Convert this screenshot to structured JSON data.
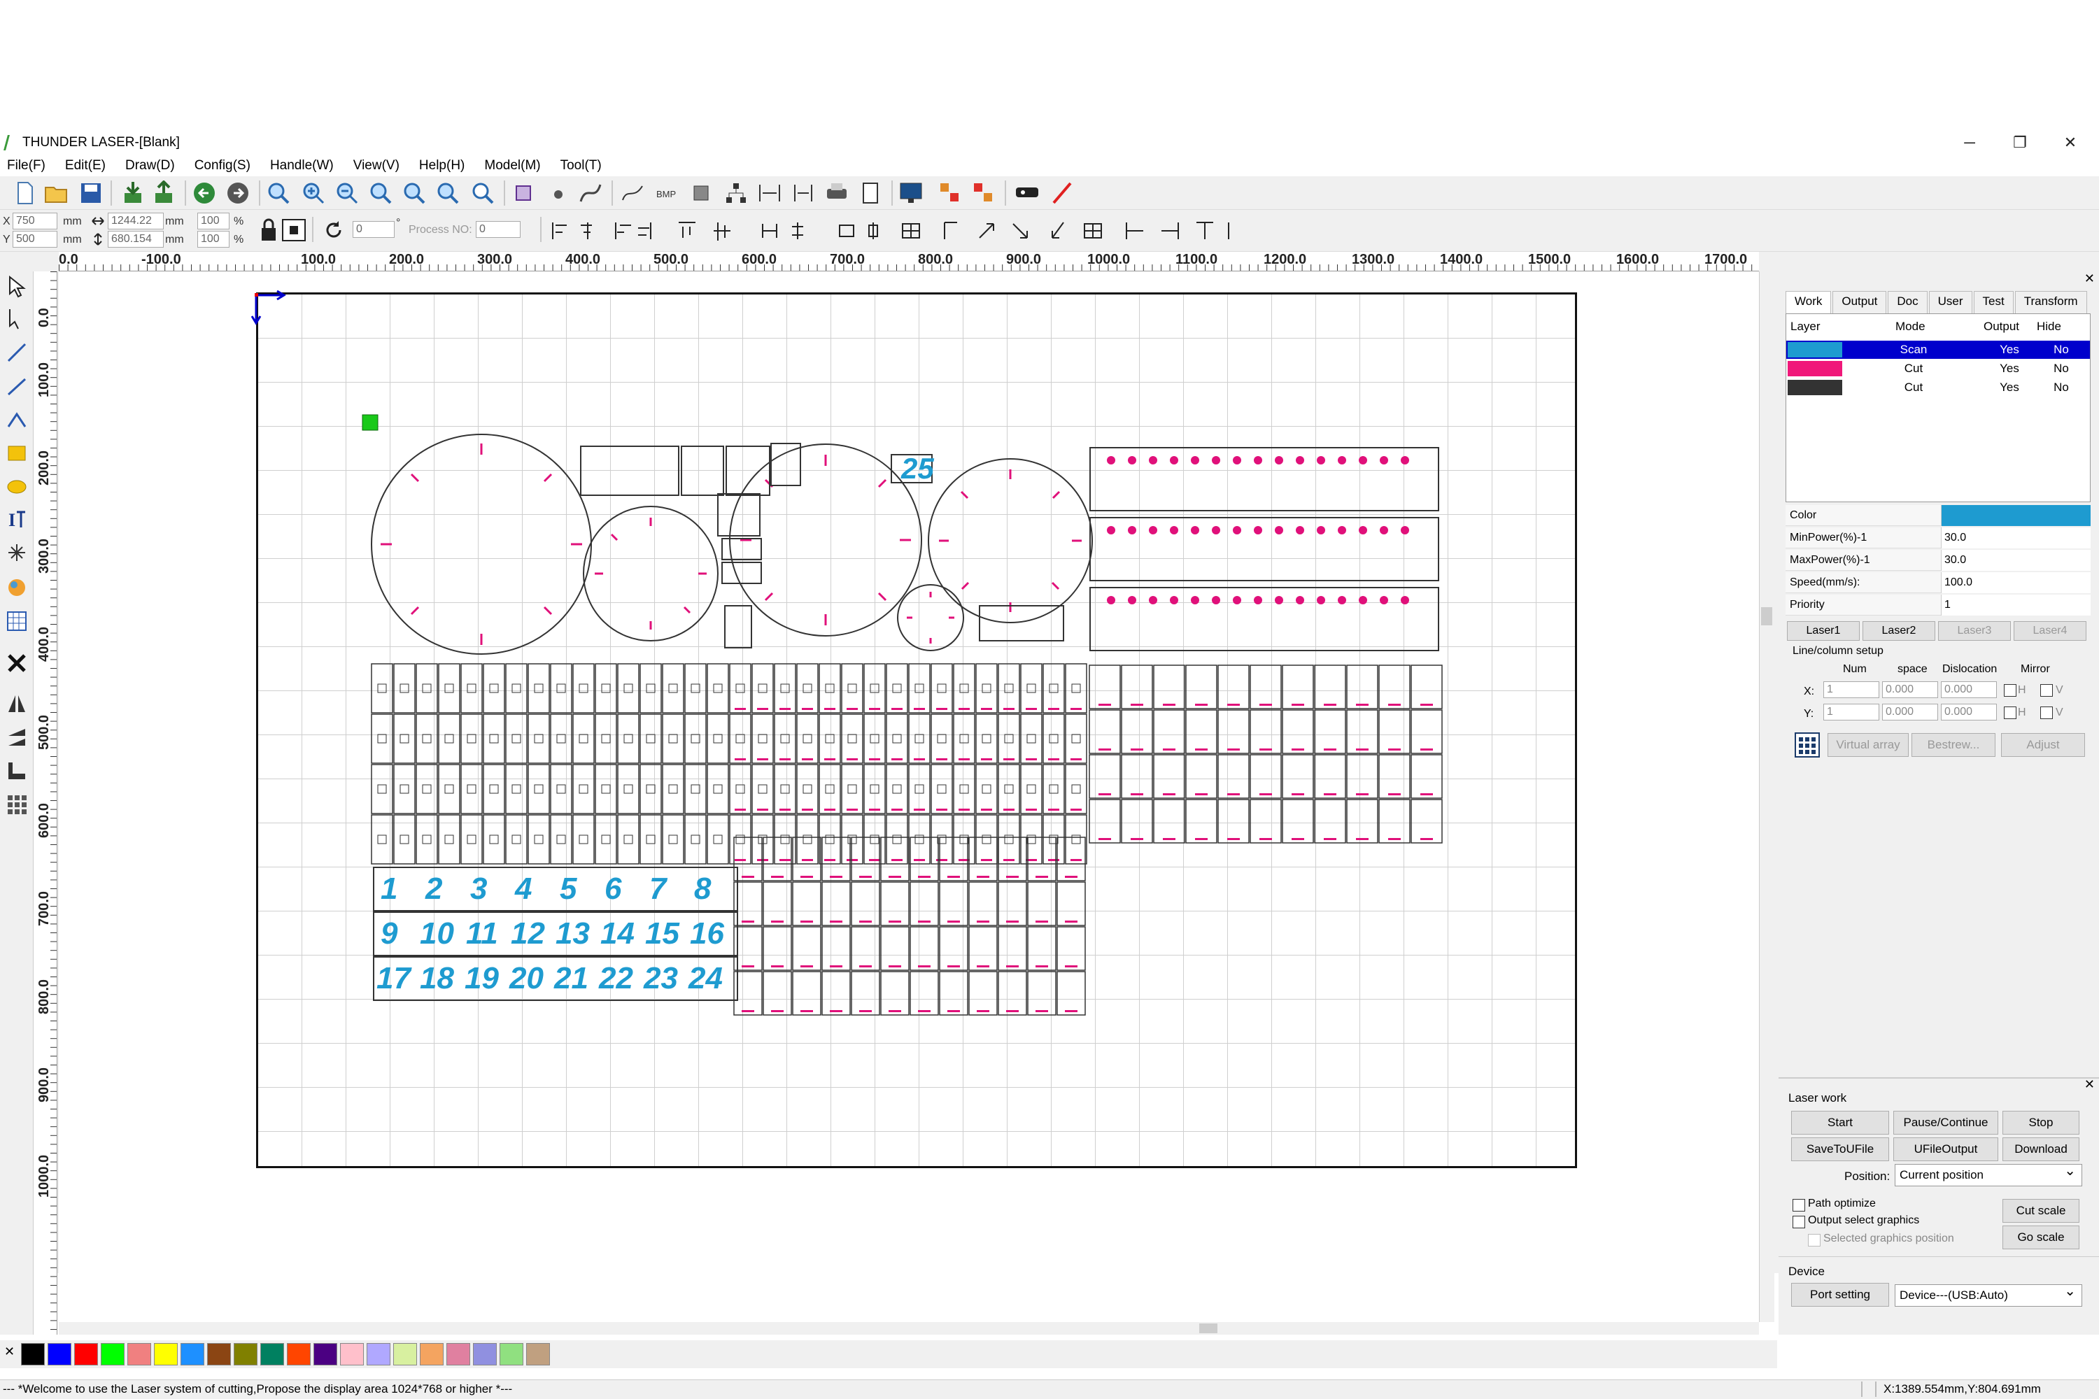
{
  "window": {
    "title": "THUNDER LASER-[Blank]",
    "minimize": "─",
    "restore": "❐",
    "close": "✕"
  },
  "menu": [
    "File(F)",
    "Edit(E)",
    "Draw(D)",
    "Config(S)",
    "Handle(W)",
    "View(V)",
    "Help(H)",
    "Model(M)",
    "Tool(T)"
  ],
  "coords": {
    "x_label": "X",
    "y_label": "Y",
    "x_value": "750",
    "y_value": "500",
    "unit": "mm",
    "w_value": "1244.22",
    "h_value": "680.154",
    "w_unit": "mm",
    "h_unit": "mm",
    "sx": "100",
    "sy": "100",
    "pct": "%",
    "angle": "0",
    "deg": "°",
    "process_label": "Process NO:",
    "process_value": "0"
  },
  "ruler_h": [
    "0.0",
    "-100.0",
    "100.0",
    "200.0",
    "300.0",
    "400.0",
    "500.0",
    "600.0",
    "700.0",
    "800.0",
    "900.0",
    "1000.0",
    "1100.0",
    "1200.0",
    "1300.0",
    "1400.0",
    "1500.0",
    "1600.0",
    "1700.0"
  ],
  "ruler_v": [
    "0.0",
    "100.0",
    "200.0",
    "300.0",
    "400.0",
    "500.0",
    "600.0",
    "700.0",
    "800.0",
    "900.0",
    "1000.0"
  ],
  "canvas": {
    "tiles": [
      "1",
      "2",
      "3",
      "4",
      "5",
      "6",
      "7",
      "8",
      "9",
      "10",
      "11",
      "12",
      "13",
      "14",
      "15",
      "16",
      "17",
      "18",
      "19",
      "20",
      "21",
      "22",
      "23",
      "24"
    ],
    "tile_25": "25"
  },
  "panel": {
    "tabs": [
      "Work",
      "Output",
      "Doc",
      "User",
      "Test",
      "Transform"
    ],
    "layer_headers": {
      "layer": "Layer",
      "mode": "Mode",
      "output": "Output",
      "hide": "Hide"
    },
    "layers": [
      {
        "color": "#1e9bd0",
        "mode": "Scan",
        "output": "Yes",
        "hide": "No"
      },
      {
        "color": "#f0187a",
        "mode": "Cut",
        "output": "Yes",
        "hide": "No"
      },
      {
        "color": "#333333",
        "mode": "Cut",
        "output": "Yes",
        "hide": "No"
      }
    ],
    "props": [
      {
        "key": "Color",
        "value": ""
      },
      {
        "key": "MinPower(%)-1",
        "value": "30.0"
      },
      {
        "key": "MaxPower(%)-1",
        "value": "30.0"
      },
      {
        "key": "Speed(mm/s):",
        "value": "100.0"
      },
      {
        "key": "Priority",
        "value": "1"
      }
    ],
    "laser_tabs": [
      "Laser1",
      "Laser2",
      "Laser3",
      "Laser4"
    ],
    "line_col": {
      "title": "Line/column setup",
      "num": "Num",
      "space": "space",
      "dislocation": "Dislocation",
      "mirror": "Mirror",
      "x_label": "X:",
      "y_label": "Y:",
      "x_num": "1",
      "y_num": "1",
      "x_space": "0.000",
      "y_space": "0.000",
      "x_disl": "0.000",
      "y_disl": "0.000",
      "h": "H",
      "v": "V"
    },
    "array_buttons": [
      "Virtual array",
      "Bestrew...",
      "Adjust"
    ],
    "laser_work": {
      "title": "Laser work",
      "buttons": [
        "Start",
        "Pause/Continue",
        "Stop",
        "SaveToUFile",
        "UFileOutput",
        "Download"
      ],
      "position_label": "Position:",
      "position_value": "Current position",
      "path_optimize": "Path optimize",
      "output_select": "Output select graphics",
      "selected_pos": "Selected graphics position",
      "cut_scale": "Cut scale",
      "go_scale": "Go scale"
    },
    "device": {
      "title": "Device",
      "port_setting": "Port setting",
      "device_value": "Device---(USB:Auto)"
    }
  },
  "palette": [
    "#000000",
    "#0000ff",
    "#ff0000",
    "#00ff00",
    "#f08080",
    "#ffff00",
    "#1e90ff",
    "#8b4513",
    "#808000",
    "#008060",
    "#ff4500",
    "#4b0082",
    "#ffc0cb",
    "#b0a8ff",
    "#d8f0a0",
    "#f4a460",
    "#e080a0",
    "#9090e0",
    "#90e080",
    "#c0a080"
  ],
  "status": {
    "message": "--- *Welcome to use the Laser system of cutting,Propose the display area 1024*768 or higher *---",
    "coords": "X:1389.554mm,Y:804.691mm"
  },
  "colors": {
    "accent_blue": "#1e9bd0",
    "magenta": "#e0107a",
    "selection": "#0000cc"
  }
}
